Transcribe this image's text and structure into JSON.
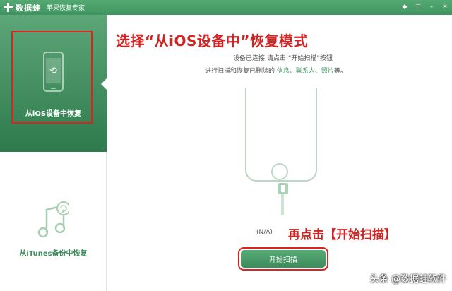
{
  "titlebar": {
    "brand": "数据蛙",
    "subtitle": "苹果恢复专家",
    "controls": {
      "gift": "◆",
      "menu": "☰",
      "minimize": "–",
      "close": "✕"
    }
  },
  "sidebar": {
    "items": [
      {
        "label": "从iOS设备中恢复",
        "icon": "phone-sync-icon",
        "icon_glyph": "⟲",
        "active": true
      },
      {
        "label": "从iTunes备份中恢复",
        "icon": "music-note-icon",
        "active": false
      }
    ]
  },
  "main": {
    "heading": "选择“从iOS设备中”恢复模式",
    "hint_line1": "设备已连接,请点击 “开始扫描”按钮",
    "hint_line2_prefix": "进行扫描和恢复已删除的 ",
    "hint_line2_highlight": "信息、联系人、照片",
    "hint_line2_suffix": "等。",
    "device_name": "(N/A)",
    "callout": "再点击【开始扫描】",
    "start_button": "开始扫描"
  },
  "watermark": "头条 @数据蛙软件",
  "colors": {
    "brand_green": "#3f9460",
    "annotation_red": "#d22323",
    "phone_outline": "#bcd6c4"
  }
}
